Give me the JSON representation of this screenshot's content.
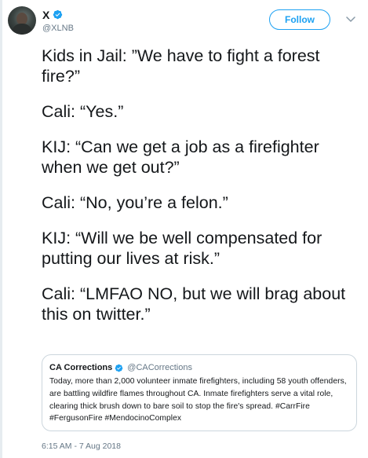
{
  "author": {
    "display_name": "X",
    "username": "@XLNB",
    "verified": true
  },
  "follow_label": "Follow",
  "tweet": {
    "paragraphs": [
      "Kids in Jail: ”We have to fight a forest\nfire?”",
      "Cali: “Yes.”",
      "KIJ: “Can we get a job as a firefighter\nwhen we get out?”",
      "Cali: “No, you’re a felon.”",
      "KIJ: “Will we be well compensated for\nputting our lives at risk.”",
      "Cali: “LMFAO NO, but we will brag about\nthis on twitter.”"
    ]
  },
  "quoted_tweet": {
    "display_name": "CA Corrections",
    "username": "@CACorrections",
    "verified": true,
    "text": "Today, more than 2,000 volunteer inmate firefighters, including 58 youth offenders, are battling wildfire flames throughout CA. Inmate firefighters serve a vital role, clearing thick brush down to bare soil to stop the fire's spread. #CarrFire #FergusonFire #MendocinoComplex"
  },
  "timestamp": "6:15 AM - 7 Aug 2018",
  "colors": {
    "accent": "#1da1f2",
    "text": "#14171a",
    "muted": "#657786",
    "border": "#ccd6dd"
  },
  "icons": {
    "verified": "verified-badge-icon",
    "caret": "chevron-down-icon"
  }
}
